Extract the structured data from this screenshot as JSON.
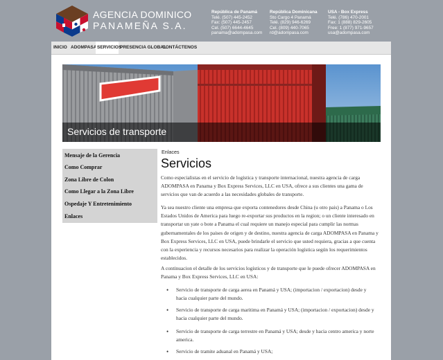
{
  "brand": {
    "line1": "AGENCIA DOMINICO",
    "line2": "PANAMEÑA S.A."
  },
  "contacts": [
    {
      "title": "República de Panamá",
      "lines": [
        "Telé. (507) 445-2452",
        "Fax: (507) 445-2457",
        "Cel. (507) 6644-4645",
        "panama@adompasa.com"
      ]
    },
    {
      "title": "República Dominicana",
      "lines": [
        "Sto Cargo 4 Panamá",
        "Telé. (829) 946-6269",
        "Cel. (809) 440-7065",
        "rd@adompasa.com"
      ]
    },
    {
      "title": "USA - Box Express",
      "lines": [
        "Telé. (786) 470-2001",
        "Fax: 1 (888) 829-2605",
        "Free: 1 (877) 971-9657",
        "usa@adompasa.com"
      ]
    }
  ],
  "nav": {
    "items": [
      "INICIO",
      "ADOMPASA",
      "SERVICIOS",
      "PRESENCIA GLOBAL",
      "CONTÁCTENOS"
    ],
    "active": "SERVICIOS"
  },
  "banner": {
    "caption": "Servicios de transporte"
  },
  "sidebar": {
    "items": [
      "Mensaje de la Gerencia",
      "Como Comprar",
      "Zona Libre de Colon",
      "Como Llegar a la Zona Libre",
      "Ospedaje Y Entretenimiento",
      "Enlaces"
    ]
  },
  "content": {
    "breadcrumb": "Enlaces",
    "title": "Servicios",
    "paragraphs": [
      "Como especialistas en el servicio de logística y transporte internacional, nuestra agencia de carga ADOMPASA en Panama y Box Express Services, LLC en USA, ofrece a sus clientes una gama de servicios que van de acuerdo a las necesidades globales de transporte.",
      "Ya sea nuestro cliente una empresa que exporta contenedores desde China (u otro pais) a Panama o Los Estados Unidos de America para luego re-exportar sus productos en la region; o un cliente interesado en transportar un yate o bote a Panama el cual requiere un manejo especial para cumplir las normas gubernamentales de los paises de origen y de destino, nuestra agencia de carga ADOMPASA en Panama y Box Express Services, LLC en USA, puede brindarle el servicio que usted requiera, gracias a que cuenta con la experiencia y recursos necesarios para realizar la operación logística según los requerimientos establecidos.",
      "A continuacion el detalle de los servicios logísticos y de transporte que le puede ofrecer ADOMPASA en Panama y Box Express Services, LLC en USA:"
    ],
    "bullets": [
      "Servicio de transporte de carga aerea en Panamá y USA; (importacion / exportacion) desde y hacia cualquier parte del mundo.",
      "Servicio de transporte de carga maritima en Panamá y USA; (importacion / exportacion) desde y hacia cualquier parte del mundo.",
      "Servicio de transporte de carga terrestre en Panamá y USA; desde y hacia centro america y norte america.",
      "Servicio de tramite aduanal en Panamá y USA;"
    ]
  }
}
